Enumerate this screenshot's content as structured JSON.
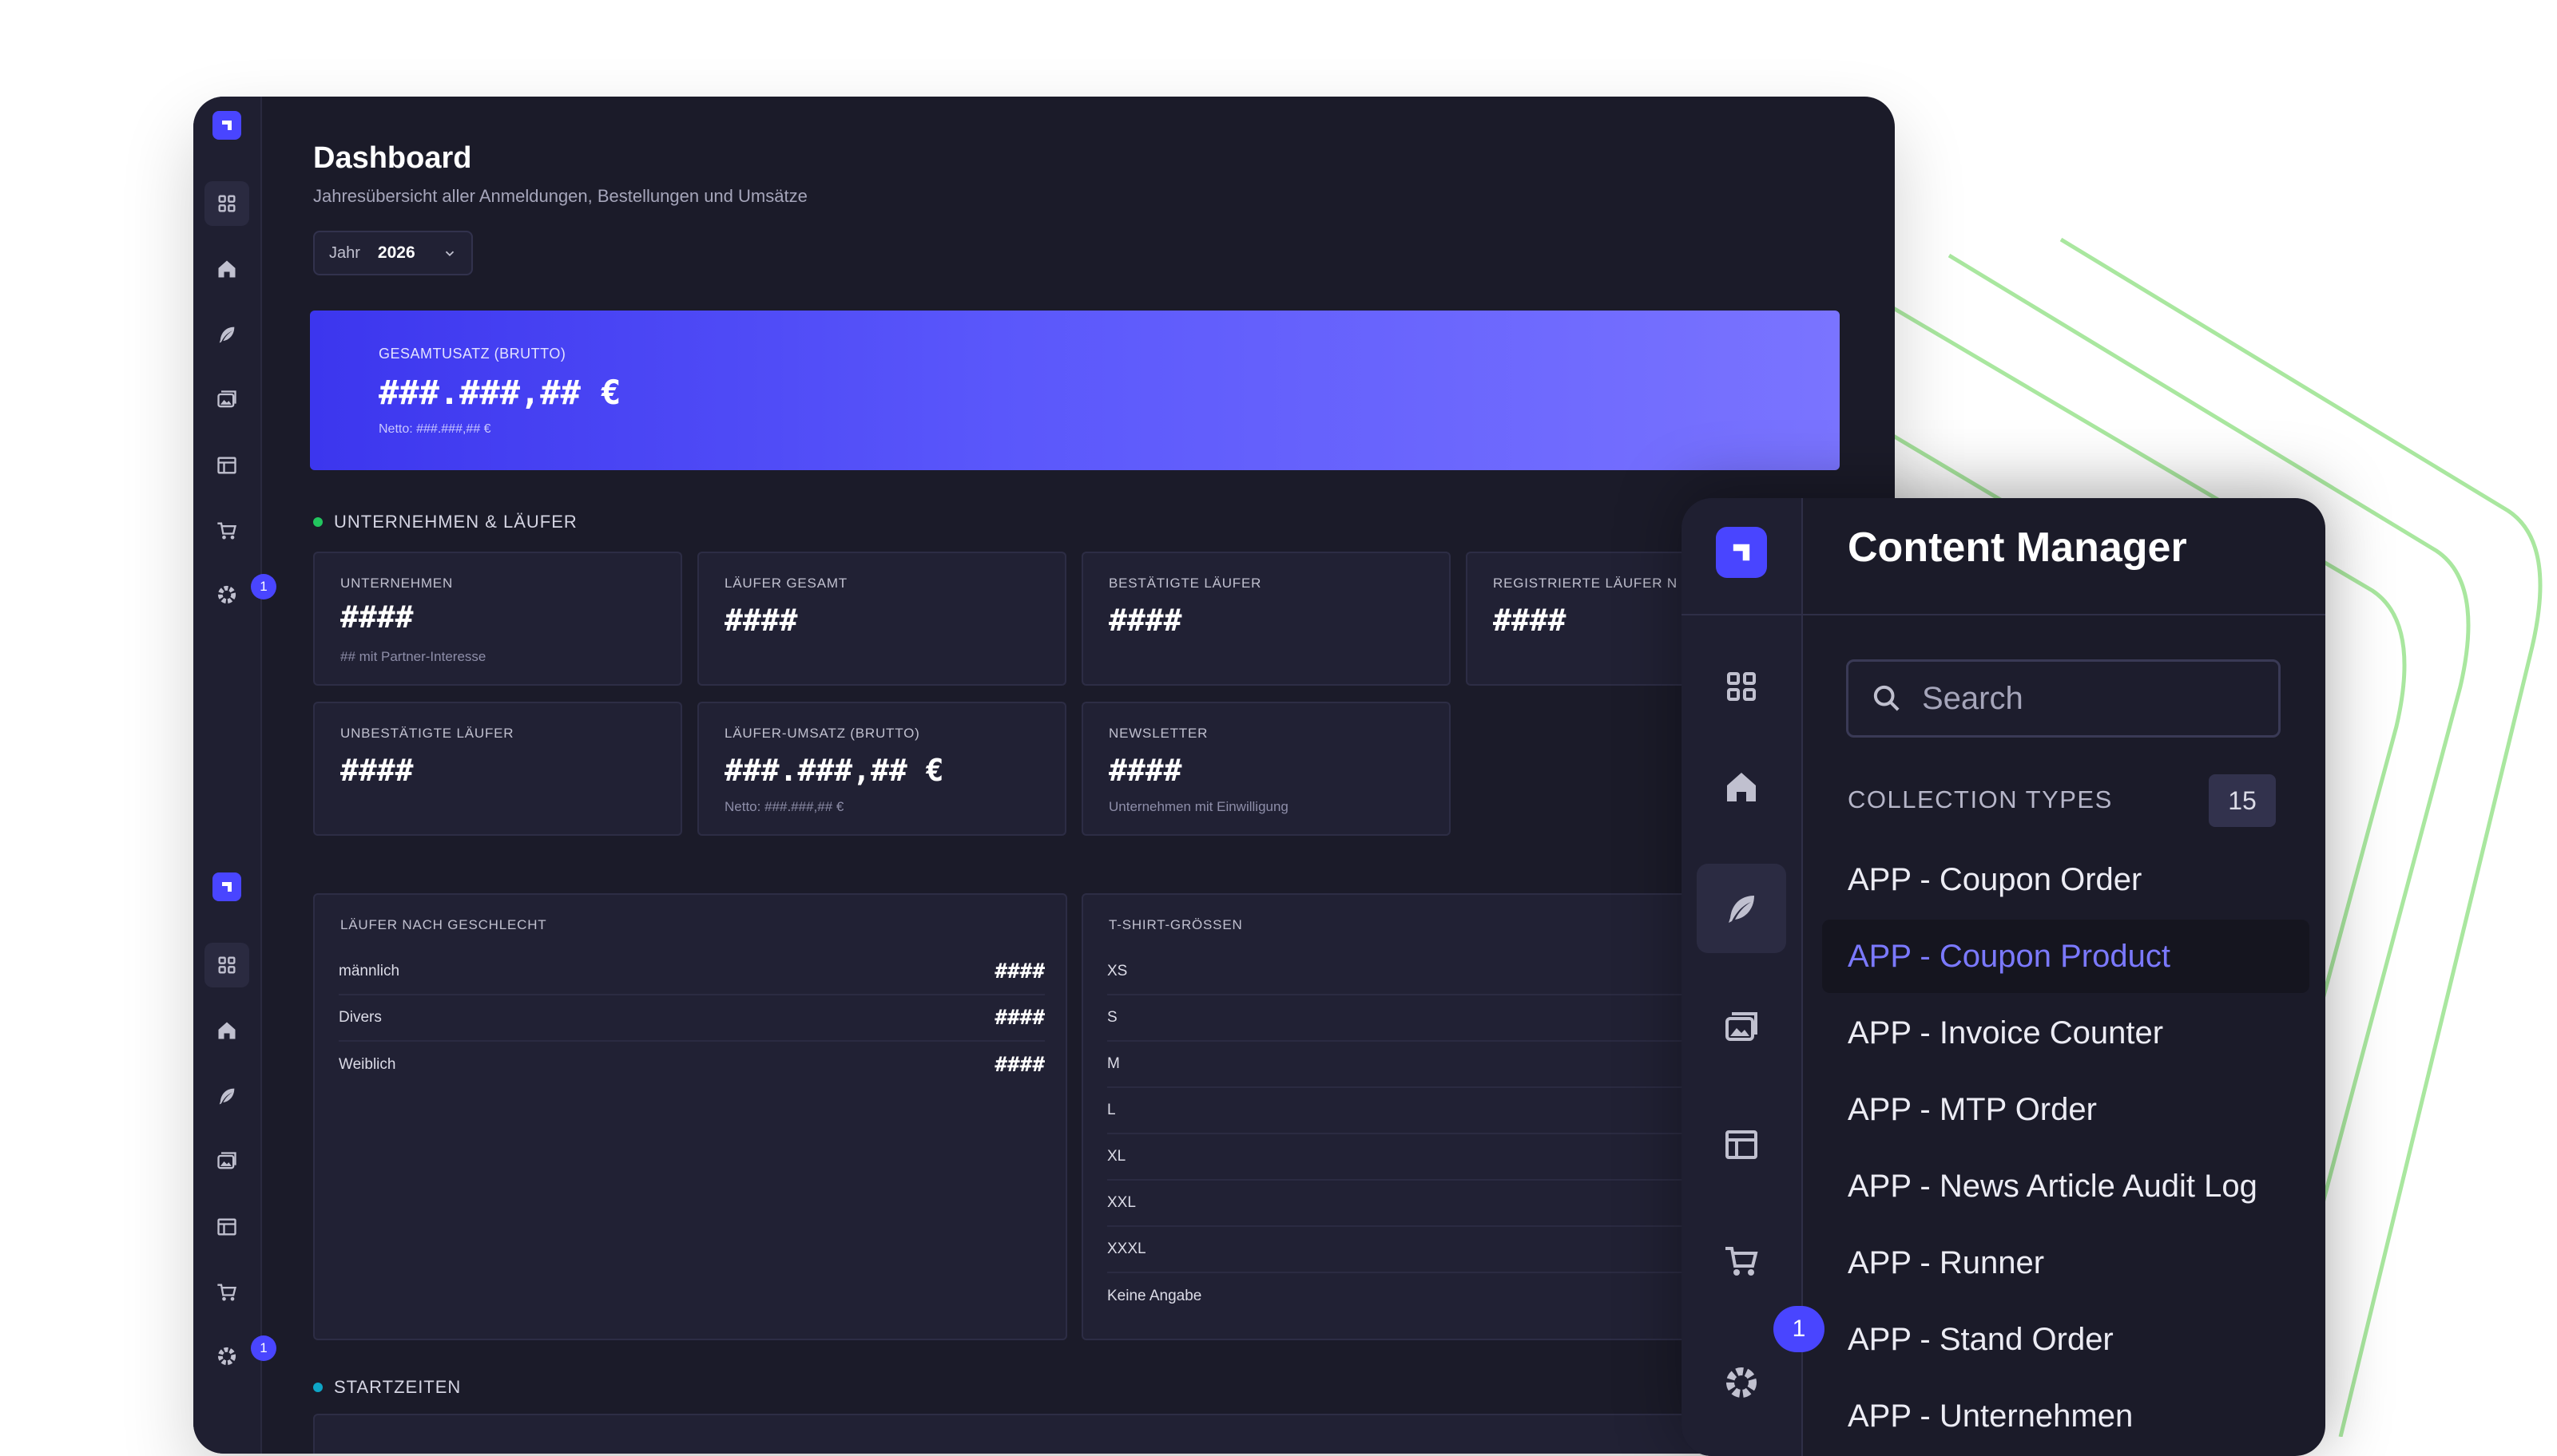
{
  "colors": {
    "accent": "#4945ff",
    "hero_start": "#3c36ee",
    "hero_end": "#7a74ff",
    "green_dot": "#22c55e",
    "teal_dot": "#0ea5c6",
    "deco_lines": "#9be38f"
  },
  "dashboard": {
    "title": "Dashboard",
    "subtitle": "Jahresübersicht aller Anmeldungen, Bestellungen und Umsätze",
    "year_label": "Jahr",
    "year_value": "2026",
    "rail_badge": "1",
    "hero": {
      "label": "GESAMTUSATZ (BRUTTO)",
      "value": "###.###,## €",
      "note": "Netto: ###.###,## €"
    },
    "section_companies": "UNTERNEHMEN & LÄUFER",
    "cards": [
      {
        "label": "UNTERNEHMEN",
        "value": "####",
        "note": "## mit Partner-Interesse"
      },
      {
        "label": "LÄUFER GESAMT",
        "value": "####",
        "note": ""
      },
      {
        "label": "BESTÄTIGTE LÄUFER",
        "value": "####",
        "note": ""
      },
      {
        "label": "REGISTRIERTE LÄUFER N",
        "value": "####",
        "note": ""
      },
      {
        "label": "UNBESTÄTIGTE LÄUFER",
        "value": "####",
        "note": ""
      },
      {
        "label": "LÄUFER-UMSATZ (BRUTTO)",
        "value": "###.###,## €",
        "note": "Netto: ###.###,## €"
      },
      {
        "label": "NEWSLETTER",
        "value": "####",
        "note": "Unternehmen mit Einwilligung"
      }
    ],
    "gender_panel": {
      "title": "LÄUFER NACH GESCHLECHT",
      "rows": [
        {
          "label": "männlich",
          "value": "####"
        },
        {
          "label": "Divers",
          "value": "####"
        },
        {
          "label": "Weiblich",
          "value": "####"
        }
      ]
    },
    "shirt_panel": {
      "title": "T-SHIRT-GRÖSSEN",
      "rows": [
        "XS",
        "S",
        "M",
        "L",
        "XL",
        "XXL",
        "XXXL",
        "Keine Angabe"
      ]
    },
    "section_start": "STARTZEITEN"
  },
  "content_manager": {
    "title": "Content Manager",
    "search_placeholder": "Search",
    "collection_types_label": "COLLECTION TYPES",
    "collection_count": "15",
    "badge": "1",
    "items": [
      "APP - Coupon Order",
      "APP - Coupon Product",
      "APP - Invoice Counter",
      "APP - MTP Order",
      "APP - News Article Audit Log",
      "APP - Runner",
      "APP - Stand Order",
      "APP - Unternehmen"
    ],
    "active_index": 1
  }
}
